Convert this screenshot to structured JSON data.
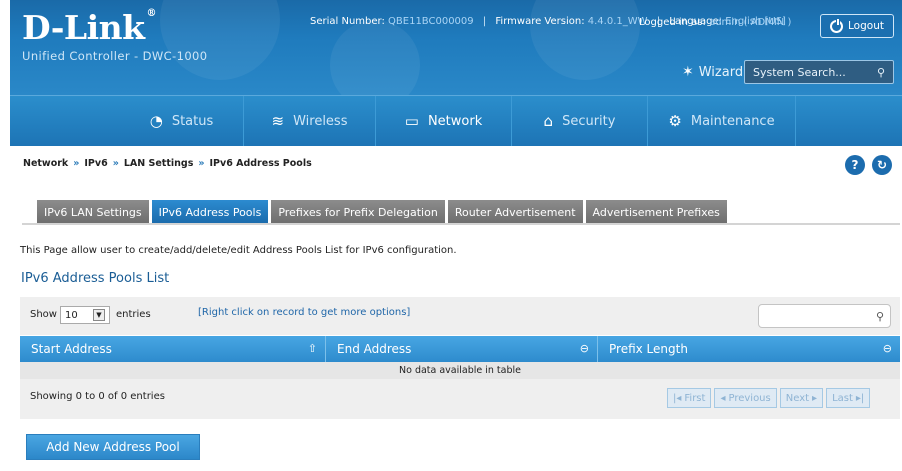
{
  "header": {
    "logo": "D-Link",
    "logo_mark": "®",
    "subtitle": "Unified Controller - DWC-1000",
    "serial_label": "Serial Number:",
    "serial_value": "QBE11BC000009",
    "firmware_label": "Firmware Version:",
    "firmware_value": "4.4.0.1_WW",
    "language_label": "Language:",
    "language_value": "English [US]",
    "logged_label": "Logged in as:",
    "logged_value": "admin ( ADMIN )",
    "logout_label": "Logout",
    "wizard_label": "Wizard",
    "search_placeholder": "System Search..."
  },
  "nav": {
    "items": [
      {
        "label": "Status",
        "icon": "dashboard-icon",
        "glyph": "◔"
      },
      {
        "label": "Wireless",
        "icon": "wifi-icon",
        "glyph": "≋"
      },
      {
        "label": "Network",
        "icon": "monitor-icon",
        "glyph": "▭"
      },
      {
        "label": "Security",
        "icon": "lock-icon",
        "glyph": "⌂"
      },
      {
        "label": "Maintenance",
        "icon": "gears-icon",
        "glyph": "⚙"
      }
    ],
    "active": "Network"
  },
  "breadcrumb": {
    "items": [
      "Network",
      "IPv6",
      "LAN Settings",
      "IPv6 Address Pools"
    ],
    "separator": "»"
  },
  "tabs": [
    {
      "label": "IPv6 LAN Settings",
      "active": false
    },
    {
      "label": "IPv6 Address Pools",
      "active": true
    },
    {
      "label": "Prefixes for Prefix Delegation",
      "active": false
    },
    {
      "label": "Router Advertisement",
      "active": false
    },
    {
      "label": "Advertisement Prefixes",
      "active": false
    }
  ],
  "page": {
    "description": "This Page allow user to create/add/delete/edit Address Pools List for IPv6 configuration.",
    "section_title": "IPv6 Address Pools List"
  },
  "table": {
    "show_label": "Show",
    "show_value": "10",
    "entries_label": "entries",
    "hint": "[Right click on record to get more options]",
    "columns": [
      "Start Address",
      "End Address",
      "Prefix Length"
    ],
    "empty_message": "No data available in table",
    "info": "Showing 0 to 0 of 0 entries",
    "pager": {
      "first": "First",
      "previous": "Previous",
      "next": "Next",
      "last": "Last"
    }
  },
  "actions": {
    "add_label": "Add New Address Pool"
  }
}
